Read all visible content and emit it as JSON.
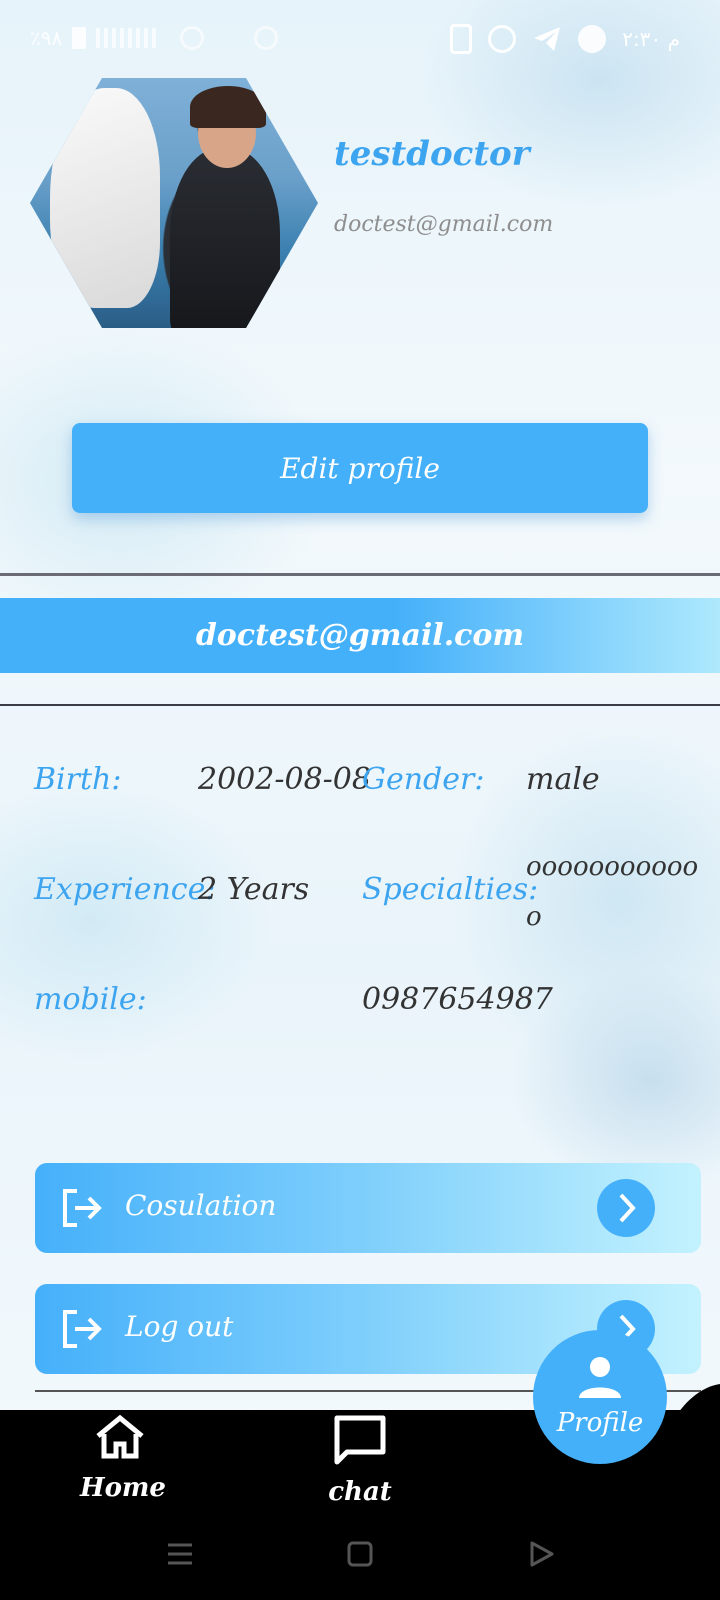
{
  "status_bar": {
    "battery": "٪۹۸",
    "time": "۲:۳۰ م"
  },
  "profile": {
    "username": "testdoctor",
    "email": "doctest@gmail.com",
    "avatar_icon": "profile-photo"
  },
  "edit_profile_label": "Edit profile",
  "email_banner": "doctest@gmail.com",
  "details": {
    "birth_label": "Birth:",
    "birth_value": "2002-08-08",
    "gender_label": "Gender:",
    "gender_value": "male",
    "experience_label": "Experience:",
    "experience_value": "2 Years",
    "specialties_label": "Specialties:",
    "specialties_value_line1": "ooooooooooo",
    "specialties_value_line2": "o",
    "mobile_label": "mobile:",
    "mobile_value": "0987654987"
  },
  "actions": [
    {
      "label": "Cosulation",
      "icon": "logout-icon"
    },
    {
      "label": "Log out",
      "icon": "logout-icon"
    }
  ],
  "nav": {
    "home_label": "Home",
    "chat_label": "chat",
    "profile_label": "Profile"
  },
  "colors": {
    "accent": "#45b0fa",
    "label_blue": "#3da4f0",
    "light_cyan": "#c3f2fe",
    "nav_bg": "#000000"
  }
}
